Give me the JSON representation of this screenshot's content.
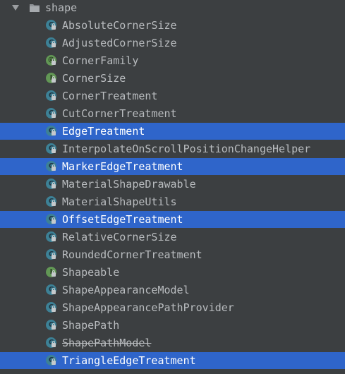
{
  "folder": {
    "name": "shape",
    "icon": "folder-icon",
    "expanded": true
  },
  "items": [
    {
      "label": "AbsoluteCornerSize",
      "kind": "class",
      "icon": "class-icon",
      "badge": "C",
      "selected": false,
      "deprecated": false
    },
    {
      "label": "AdjustedCornerSize",
      "kind": "class",
      "icon": "class-icon",
      "badge": "C",
      "selected": false,
      "deprecated": false
    },
    {
      "label": "CornerFamily",
      "kind": "annotation",
      "icon": "annotation-icon",
      "badge": "@",
      "selected": false,
      "deprecated": false
    },
    {
      "label": "CornerSize",
      "kind": "interface",
      "icon": "interface-icon",
      "badge": "I",
      "selected": false,
      "deprecated": false
    },
    {
      "label": "CornerTreatment",
      "kind": "class",
      "icon": "class-icon",
      "badge": "C",
      "selected": false,
      "deprecated": false
    },
    {
      "label": "CutCornerTreatment",
      "kind": "class",
      "icon": "class-icon",
      "badge": "C",
      "selected": false,
      "deprecated": false
    },
    {
      "label": "EdgeTreatment",
      "kind": "class",
      "icon": "class-icon",
      "badge": "C",
      "selected": true,
      "deprecated": false
    },
    {
      "label": "InterpolateOnScrollPositionChangeHelper",
      "kind": "class",
      "icon": "class-icon",
      "badge": "C",
      "selected": false,
      "deprecated": false
    },
    {
      "label": "MarkerEdgeTreatment",
      "kind": "class",
      "icon": "class-icon",
      "badge": "C",
      "selected": true,
      "deprecated": false
    },
    {
      "label": "MaterialShapeDrawable",
      "kind": "class",
      "icon": "class-icon",
      "badge": "C",
      "selected": false,
      "deprecated": false
    },
    {
      "label": "MaterialShapeUtils",
      "kind": "class",
      "icon": "class-icon",
      "badge": "C",
      "selected": false,
      "deprecated": false
    },
    {
      "label": "OffsetEdgeTreatment",
      "kind": "class",
      "icon": "class-icon",
      "badge": "C",
      "selected": true,
      "deprecated": false
    },
    {
      "label": "RelativeCornerSize",
      "kind": "class",
      "icon": "class-icon",
      "badge": "C",
      "selected": false,
      "deprecated": false
    },
    {
      "label": "RoundedCornerTreatment",
      "kind": "class",
      "icon": "class-icon",
      "badge": "C",
      "selected": false,
      "deprecated": false
    },
    {
      "label": "Shapeable",
      "kind": "interface",
      "icon": "interface-icon",
      "badge": "I",
      "selected": false,
      "deprecated": false
    },
    {
      "label": "ShapeAppearanceModel",
      "kind": "class",
      "icon": "class-icon",
      "badge": "C",
      "selected": false,
      "deprecated": false
    },
    {
      "label": "ShapeAppearancePathProvider",
      "kind": "class",
      "icon": "class-icon",
      "badge": "C",
      "selected": false,
      "deprecated": false
    },
    {
      "label": "ShapePath",
      "kind": "class",
      "icon": "class-icon",
      "badge": "C",
      "selected": false,
      "deprecated": false
    },
    {
      "label": "ShapePathModel",
      "kind": "class",
      "icon": "class-icon",
      "badge": "C",
      "selected": false,
      "deprecated": true
    },
    {
      "label": "TriangleEdgeTreatment",
      "kind": "class",
      "icon": "class-icon",
      "badge": "C",
      "selected": true,
      "deprecated": false
    }
  ],
  "colors": {
    "background": "#3c3f41",
    "selection": "#2f65ca",
    "text": "#b9bcbf",
    "selected_text": "#ffffff",
    "class_badge": "#3d8196",
    "interface_badge": "#629755"
  }
}
